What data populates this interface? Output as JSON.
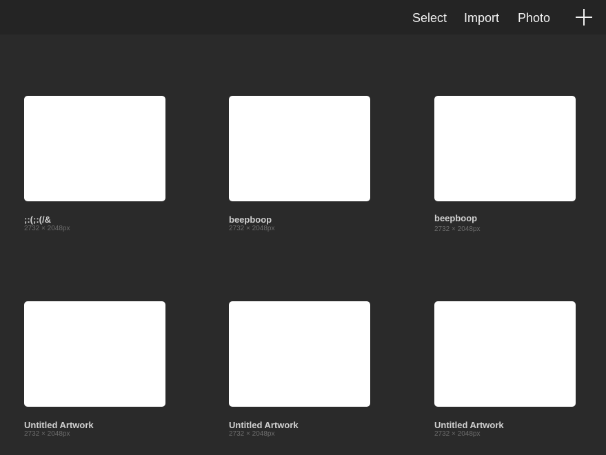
{
  "toolbar": {
    "select_label": "Select",
    "import_label": "Import",
    "photo_label": "Photo",
    "add_icon": "plus-icon"
  },
  "gallery": {
    "artworks": [
      {
        "title": ";:(;:(/&",
        "dimensions": "2732 × 2048px"
      },
      {
        "title": "beepboop",
        "dimensions": "2732 × 2048px"
      },
      {
        "title": "beepboop",
        "dimensions": "2732 × 2048px"
      },
      {
        "title": "Untitled Artwork",
        "dimensions": "2732 × 2048px"
      },
      {
        "title": "Untitled Artwork",
        "dimensions": "2732 × 2048px"
      },
      {
        "title": "Untitled Artwork",
        "dimensions": "2732 × 2048px"
      }
    ]
  },
  "colors": {
    "background": "#2a2a2a",
    "toolbar_background": "#242424",
    "thumbnail": "#ffffff",
    "text": "#f2f2f2"
  }
}
